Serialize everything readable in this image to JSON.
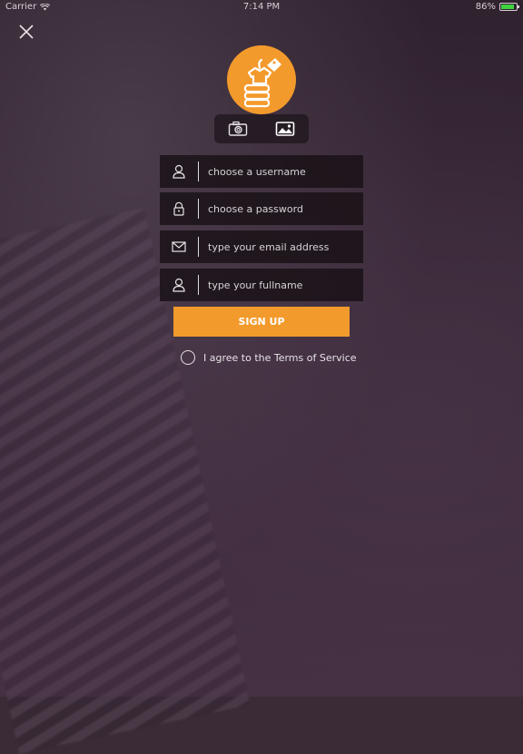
{
  "status_bar": {
    "carrier": "Carrier",
    "time": "7:14 PM",
    "battery_text": "86%",
    "battery_level": 0.86
  },
  "photo_picker": {
    "camera_icon": "camera-icon",
    "gallery_icon": "image-icon"
  },
  "form": {
    "username": {
      "placeholder": "choose a username",
      "icon": "user-icon"
    },
    "password": {
      "placeholder": "choose a password",
      "icon": "lock-icon"
    },
    "email": {
      "placeholder": "type your email address",
      "icon": "envelope-icon"
    },
    "fullname": {
      "placeholder": "type your fullname",
      "icon": "user-icon"
    }
  },
  "signup_button": {
    "label": "SIGN UP"
  },
  "terms": {
    "label": "I agree to the Terms of Service"
  },
  "colors": {
    "accent": "#f39a2c",
    "field_bg": "#161014",
    "text": "#e8e2e6"
  }
}
